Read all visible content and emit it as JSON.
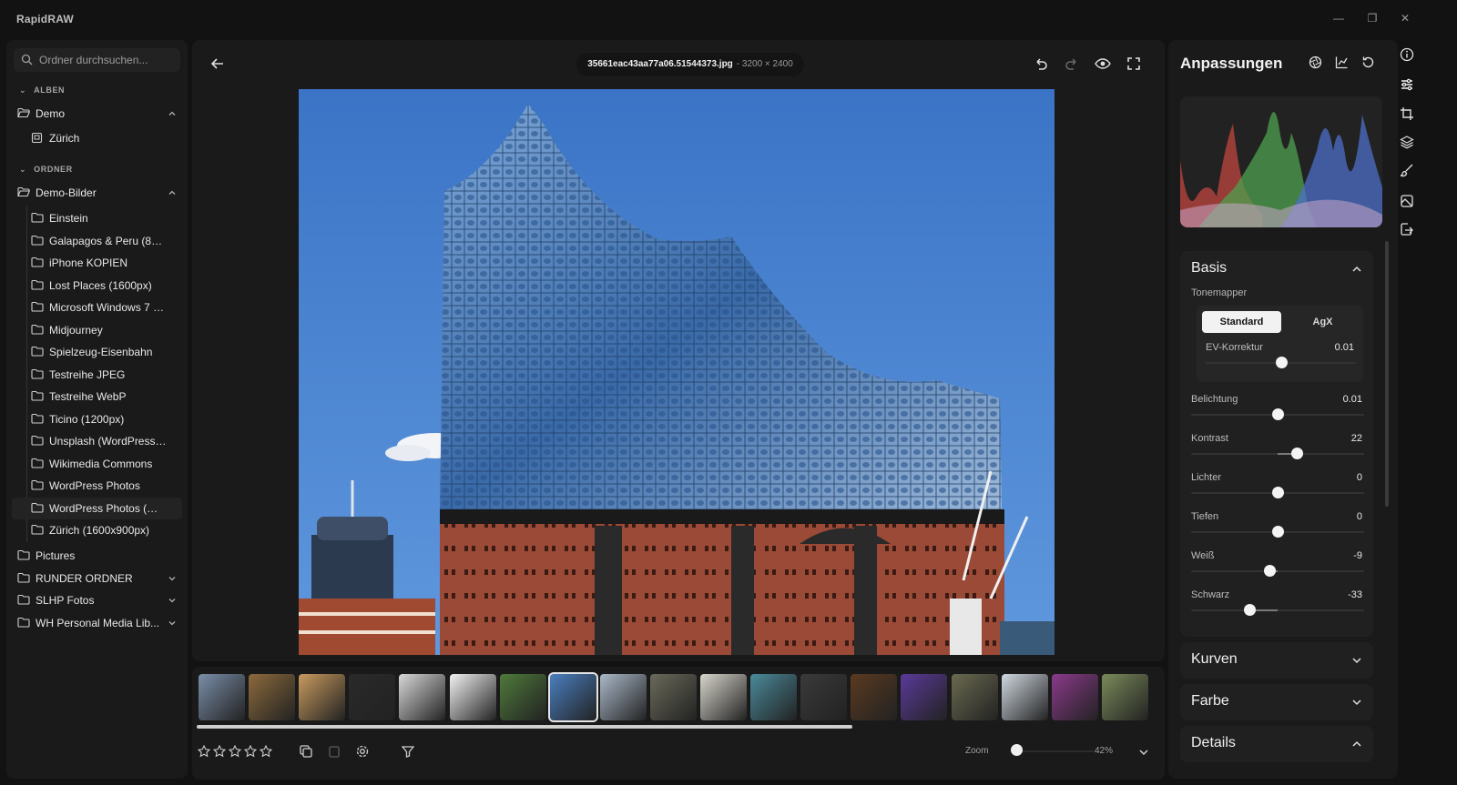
{
  "app": {
    "title": "RapidRAW"
  },
  "window": {
    "minimize_icon": "minimize-icon",
    "restore_icon": "restore-icon",
    "close_icon": "close-icon"
  },
  "sidebar": {
    "search_placeholder": "Ordner durchsuchen...",
    "albums_header": "ALBEN",
    "albums": [
      {
        "label": "Demo",
        "icon": "folder-open-icon",
        "expanded": true
      },
      {
        "label": "Zürich",
        "icon": "album-icon"
      }
    ],
    "folders_header": "ORDNER",
    "root_folder": {
      "label": "Demo-Bilder",
      "icon": "folder-open-icon",
      "expanded": true
    },
    "subfolders": [
      "Einstein",
      "Galapagos & Peru (800...",
      "iPhone KOPIEN",
      "Lost Places (1600px)",
      "Microsoft Windows 7 (10...",
      "Midjourney",
      "Spielzeug-Eisenbahn",
      "Testreihe JPEG",
      "Testreihe WebP",
      "Ticino (1200px)",
      "Unsplash (WordPress Z...",
      "Wikimedia Commons",
      "WordPress Photos",
      "WordPress Photos (My S...",
      "Zürich (1600x900px)"
    ],
    "active_subfolder_index": 13,
    "other_folders": [
      {
        "label": "Pictures",
        "expandable": false
      },
      {
        "label": "RUNDER ORDNER",
        "expandable": true
      },
      {
        "label": "SLHP Fotos",
        "expandable": true
      },
      {
        "label": "WH Personal Media Lib...",
        "expandable": true
      }
    ]
  },
  "viewer": {
    "filename": "35661eac43aa77a06.51544373.jpg",
    "dimensions": "- 3200 × 2400"
  },
  "filmstrip": {
    "selected_index": 7,
    "thumb_count": 19,
    "thumb_colors": [
      "#7a8ea8",
      "#8c6a3c",
      "#c89a5e",
      "#2a2a2a",
      "#d8d8d8",
      "#f2f2f2",
      "#4e7a3a",
      "#4a7fc0",
      "#aab8c8",
      "#6a6a5a",
      "#d8d6cc",
      "#4a8a9a",
      "#3a3a3a",
      "#5a3a20",
      "#5a3a9a",
      "#6a6a50",
      "#d0d8e0",
      "#8a3a8a",
      "#7a8a5a"
    ]
  },
  "bottombar": {
    "rating": 0,
    "zoom_label": "Zoom",
    "zoom_value": "42%",
    "zoom_level": 0.05
  },
  "panel": {
    "title": "Anpassungen",
    "basis": {
      "title": "Basis",
      "tonemapper_label": "Tonemapper",
      "tonemapper_options": [
        "Standard",
        "AgX"
      ],
      "tonemapper_selected": "Standard",
      "ev": {
        "name": "EV-Korrektur",
        "value": "0.01",
        "pos": 0.5
      },
      "sliders": [
        {
          "name": "Belichtung",
          "value": "0.01",
          "pos": 0.5
        },
        {
          "name": "Kontrast",
          "value": "22",
          "pos": 0.61
        },
        {
          "name": "Lichter",
          "value": "0",
          "pos": 0.5
        },
        {
          "name": "Tiefen",
          "value": "0",
          "pos": 0.5
        },
        {
          "name": "Weiß",
          "value": "-9",
          "pos": 0.455
        },
        {
          "name": "Schwarz",
          "value": "-33",
          "pos": 0.335
        }
      ]
    },
    "sections": [
      {
        "title": "Kurven",
        "expanded": false
      },
      {
        "title": "Farbe",
        "expanded": false
      },
      {
        "title": "Details",
        "expanded": true
      }
    ]
  },
  "rail": {
    "icons": [
      "info-icon",
      "adjustments-icon",
      "crop-icon",
      "layers-icon",
      "brush-icon",
      "presets-icon",
      "export-icon"
    ],
    "active_index": 1
  },
  "colors": {
    "bg": "#121212",
    "panel": "#1a1a1a",
    "card": "#202020",
    "accent": "#f2f2f2"
  }
}
